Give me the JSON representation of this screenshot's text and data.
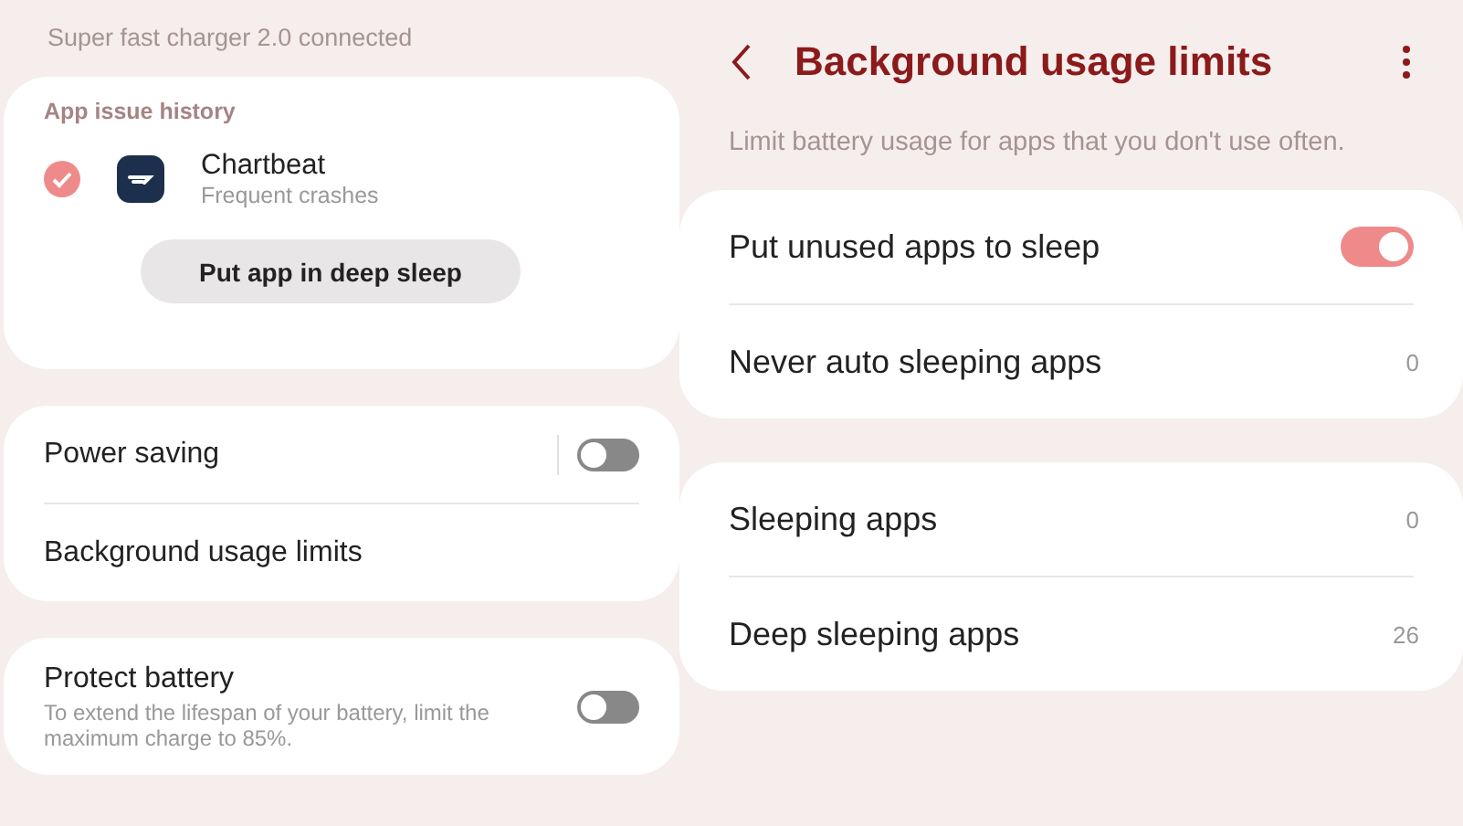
{
  "left": {
    "status_text": "Super fast charger 2.0 connected",
    "issue_card": {
      "title": "App issue history",
      "apps": [
        {
          "name": "Chartbeat",
          "subtitle": "Frequent crashes",
          "checked": true
        }
      ],
      "button": "Put app in deep sleep"
    },
    "groups": [
      {
        "rows": [
          {
            "kind": "toggle",
            "label": "Power saving",
            "on": false
          },
          {
            "kind": "link",
            "label": "Background usage limits"
          }
        ]
      },
      {
        "rows": [
          {
            "kind": "toggle",
            "label": "Protect battery",
            "description": "To extend the lifespan of your battery, limit the maximum charge to 85%.",
            "on": false
          }
        ]
      }
    ]
  },
  "right": {
    "title": "Background usage limits",
    "subtitle": "Limit battery usage for apps that you don't use often.",
    "groups": [
      {
        "rows": [
          {
            "kind": "toggle",
            "label": "Put unused apps to sleep",
            "on": true
          },
          {
            "kind": "count",
            "label": "Never auto sleeping apps",
            "count": "0"
          }
        ]
      },
      {
        "rows": [
          {
            "kind": "count",
            "label": "Sleeping apps",
            "count": "0"
          },
          {
            "kind": "count",
            "label": "Deep sleeping apps",
            "count": "26"
          }
        ]
      }
    ]
  }
}
